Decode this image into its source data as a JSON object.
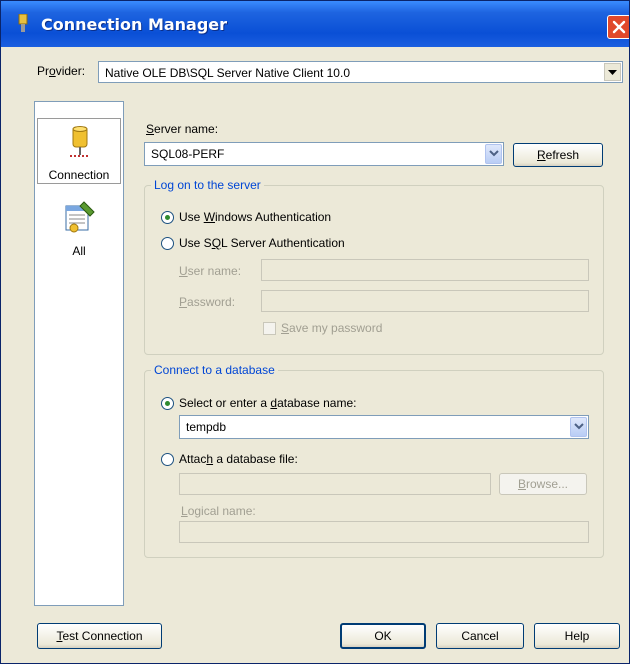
{
  "window": {
    "title": "Connection Manager"
  },
  "provider": {
    "label_pre": "Pr",
    "label_key": "o",
    "label_post": "vider:",
    "value": "Native OLE DB\\SQL Server Native Client 10.0"
  },
  "sidebar": {
    "items": [
      {
        "label": "Connection"
      },
      {
        "label": "All"
      }
    ]
  },
  "server": {
    "label_pre": "",
    "label_key": "S",
    "label_post": "erver name:",
    "value": "SQL08-PERF",
    "refresh_key": "R",
    "refresh_post": "efresh"
  },
  "logon": {
    "title": "Log on to the server",
    "windows_pre": "Use ",
    "windows_key": "W",
    "windows_post": "indows Authentication",
    "sql_pre": "Use S",
    "sql_key": "Q",
    "sql_post": "L Server Authentication",
    "user_key": "U",
    "user_post": "ser name:",
    "pass_key": "P",
    "pass_post": "assword:",
    "save_key": "S",
    "save_post": "ave my password"
  },
  "database": {
    "title": "Connect to a database",
    "select_pre": "Select or enter a ",
    "select_key": "d",
    "select_post": "atabase name:",
    "db_value": "tempdb",
    "attach_pre": "Attac",
    "attach_key": "h",
    "attach_post": " a database file:",
    "browse_key": "B",
    "browse_post": "rowse...",
    "logical_key": "L",
    "logical_post": "ogical name:"
  },
  "footer": {
    "test_key": "T",
    "test_post": "est Connection",
    "ok": "OK",
    "cancel": "Cancel",
    "help": "Help"
  }
}
